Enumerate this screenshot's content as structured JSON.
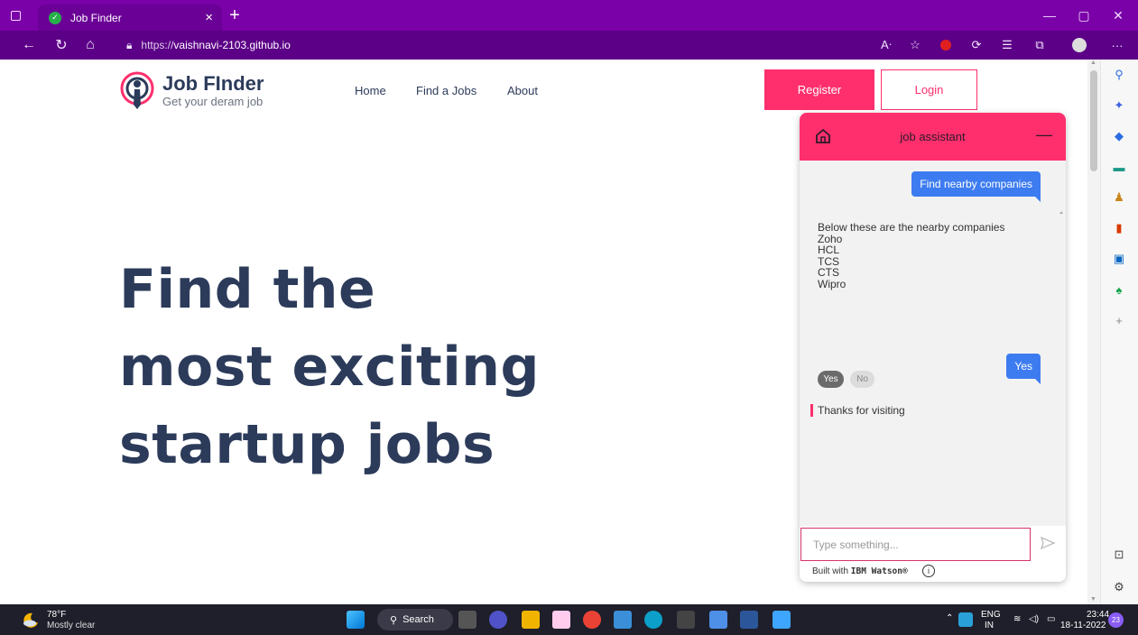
{
  "browser": {
    "tab_title": "Job Finder",
    "url_prefix": "https://",
    "url_host": "vaishnavi-2103.github.io"
  },
  "site": {
    "logo_title": "Job FInder",
    "logo_subtitle": "Get your deram job",
    "nav": [
      "Home",
      "Find a Jobs",
      "About"
    ],
    "register_label": "Register",
    "login_label": "Login",
    "hero_lines": [
      "Find the",
      "most exciting",
      "startup jobs"
    ]
  },
  "chat": {
    "title": "job assistant",
    "messages": {
      "user_1": "Find nearby companies",
      "bot_intro": "Below these are the nearby companies",
      "companies": [
        "Zoho",
        "HCL",
        "TCS",
        "CTS",
        "Wipro"
      ],
      "option_yes": "Yes",
      "option_no": "No",
      "user_2": "Yes",
      "bot_thanks": "Thanks for visiting"
    },
    "input_placeholder": "Type something...",
    "built_with_prefix": "Built with ",
    "built_with_brand": "IBM Watson®",
    "accent_color": "#ff2f6d",
    "user_bubble_color": "#3d7cf0"
  },
  "taskbar": {
    "temperature": "78°F",
    "weather": "Mostly clear",
    "search_label": "Search",
    "lang_top": "ENG",
    "lang_bottom": "IN",
    "time": "23:44",
    "date": "18-11-2022",
    "notification_count": "23"
  }
}
